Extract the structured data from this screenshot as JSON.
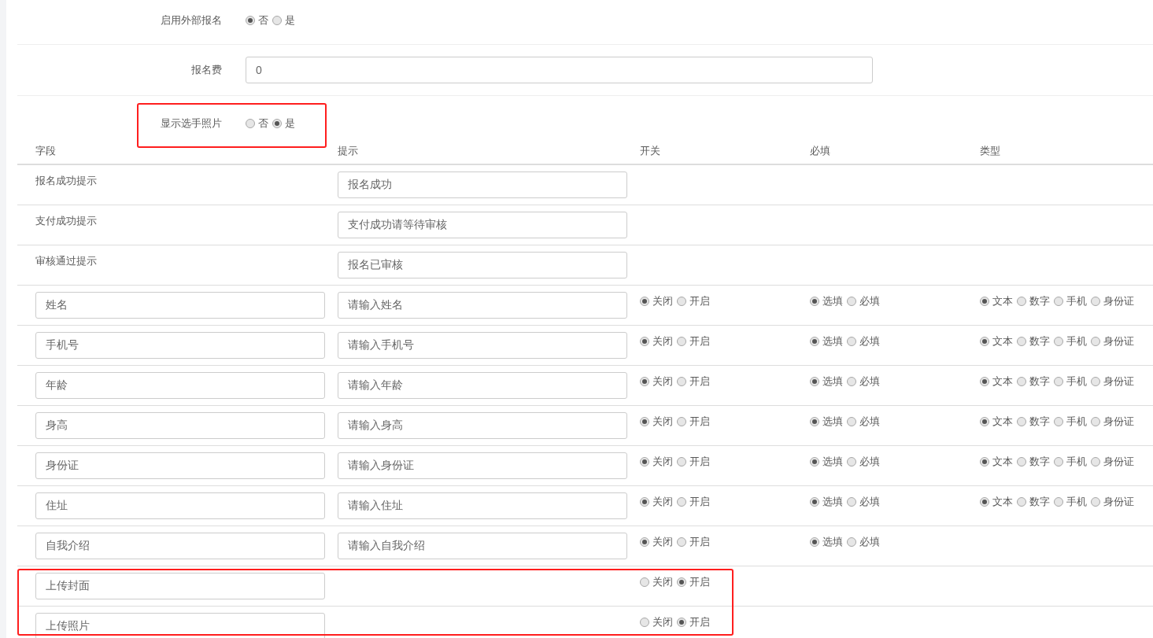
{
  "settings": [
    {
      "kind": "radio",
      "label": "启用外部报名",
      "highlighted": false,
      "options": [
        {
          "label": "否",
          "selected": true
        },
        {
          "label": "是",
          "selected": false
        }
      ]
    },
    {
      "kind": "input",
      "label": "报名费",
      "value": "0"
    },
    {
      "kind": "radio",
      "label": "显示选手照片",
      "highlighted": true,
      "options": [
        {
          "label": "否",
          "selected": false
        },
        {
          "label": "是",
          "selected": true
        }
      ]
    }
  ],
  "table": {
    "columns": [
      "字段",
      "提示",
      "开关",
      "必填",
      "类型"
    ],
    "rows": [
      {
        "kind": "message",
        "label": "报名成功提示",
        "tip": "报名成功"
      },
      {
        "kind": "message",
        "label": "支付成功提示",
        "tip": "支付成功请等待审核"
      },
      {
        "kind": "message",
        "label": "审核通过提示",
        "tip": "报名已审核"
      },
      {
        "kind": "field",
        "field": "姓名",
        "tip": "请输入姓名",
        "highlighted": false,
        "switch": [
          {
            "label": "关闭",
            "selected": true
          },
          {
            "label": "开启",
            "selected": false
          }
        ],
        "required": [
          {
            "label": "选填",
            "selected": true
          },
          {
            "label": "必填",
            "selected": false
          }
        ],
        "type": [
          {
            "label": "文本",
            "selected": true
          },
          {
            "label": "数字",
            "selected": false
          },
          {
            "label": "手机",
            "selected": false
          },
          {
            "label": "身份证",
            "selected": false
          }
        ]
      },
      {
        "kind": "field",
        "field": "手机号",
        "tip": "请输入手机号",
        "highlighted": false,
        "switch": [
          {
            "label": "关闭",
            "selected": true
          },
          {
            "label": "开启",
            "selected": false
          }
        ],
        "required": [
          {
            "label": "选填",
            "selected": true
          },
          {
            "label": "必填",
            "selected": false
          }
        ],
        "type": [
          {
            "label": "文本",
            "selected": true
          },
          {
            "label": "数字",
            "selected": false
          },
          {
            "label": "手机",
            "selected": false
          },
          {
            "label": "身份证",
            "selected": false
          }
        ]
      },
      {
        "kind": "field",
        "field": "年龄",
        "tip": "请输入年龄",
        "highlighted": false,
        "switch": [
          {
            "label": "关闭",
            "selected": true
          },
          {
            "label": "开启",
            "selected": false
          }
        ],
        "required": [
          {
            "label": "选填",
            "selected": true
          },
          {
            "label": "必填",
            "selected": false
          }
        ],
        "type": [
          {
            "label": "文本",
            "selected": true
          },
          {
            "label": "数字",
            "selected": false
          },
          {
            "label": "手机",
            "selected": false
          },
          {
            "label": "身份证",
            "selected": false
          }
        ]
      },
      {
        "kind": "field",
        "field": "身高",
        "tip": "请输入身高",
        "highlighted": false,
        "switch": [
          {
            "label": "关闭",
            "selected": true
          },
          {
            "label": "开启",
            "selected": false
          }
        ],
        "required": [
          {
            "label": "选填",
            "selected": true
          },
          {
            "label": "必填",
            "selected": false
          }
        ],
        "type": [
          {
            "label": "文本",
            "selected": true
          },
          {
            "label": "数字",
            "selected": false
          },
          {
            "label": "手机",
            "selected": false
          },
          {
            "label": "身份证",
            "selected": false
          }
        ]
      },
      {
        "kind": "field",
        "field": "身份证",
        "tip": "请输入身份证",
        "highlighted": false,
        "switch": [
          {
            "label": "关闭",
            "selected": true
          },
          {
            "label": "开启",
            "selected": false
          }
        ],
        "required": [
          {
            "label": "选填",
            "selected": true
          },
          {
            "label": "必填",
            "selected": false
          }
        ],
        "type": [
          {
            "label": "文本",
            "selected": true
          },
          {
            "label": "数字",
            "selected": false
          },
          {
            "label": "手机",
            "selected": false
          },
          {
            "label": "身份证",
            "selected": false
          }
        ]
      },
      {
        "kind": "field",
        "field": "住址",
        "tip": "请输入住址",
        "highlighted": false,
        "switch": [
          {
            "label": "关闭",
            "selected": true
          },
          {
            "label": "开启",
            "selected": false
          }
        ],
        "required": [
          {
            "label": "选填",
            "selected": true
          },
          {
            "label": "必填",
            "selected": false
          }
        ],
        "type": [
          {
            "label": "文本",
            "selected": true
          },
          {
            "label": "数字",
            "selected": false
          },
          {
            "label": "手机",
            "selected": false
          },
          {
            "label": "身份证",
            "selected": false
          }
        ]
      },
      {
        "kind": "field",
        "field": "自我介绍",
        "tip": "请输入自我介绍",
        "highlighted": false,
        "switch": [
          {
            "label": "关闭",
            "selected": true
          },
          {
            "label": "开启",
            "selected": false
          }
        ],
        "required": [
          {
            "label": "选填",
            "selected": true
          },
          {
            "label": "必填",
            "selected": false
          }
        ]
      },
      {
        "kind": "field",
        "field": "上传封面",
        "highlighted": true,
        "switch": [
          {
            "label": "关闭",
            "selected": false
          },
          {
            "label": "开启",
            "selected": true
          }
        ]
      },
      {
        "kind": "field",
        "field": "上传照片",
        "highlighted": true,
        "switch": [
          {
            "label": "关闭",
            "selected": false
          },
          {
            "label": "开启",
            "selected": true
          }
        ]
      }
    ]
  }
}
